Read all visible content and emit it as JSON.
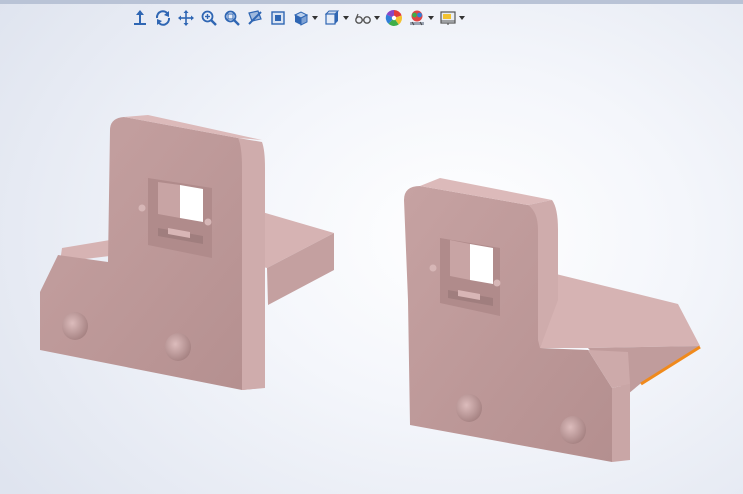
{
  "toolbar": {
    "items": [
      {
        "icon": "view-orientation-icon",
        "has_dropdown": false
      },
      {
        "icon": "rotate-view-icon",
        "has_dropdown": false
      },
      {
        "icon": "pan-icon",
        "has_dropdown": false
      },
      {
        "icon": "zoom-in-out-icon",
        "has_dropdown": false
      },
      {
        "icon": "zoom-to-area-icon",
        "has_dropdown": false
      },
      {
        "icon": "section-view-icon",
        "has_dropdown": false
      },
      {
        "icon": "previous-view-icon",
        "has_dropdown": false
      },
      {
        "icon": "view-orientation-cube-icon",
        "has_dropdown": true
      },
      {
        "icon": "display-style-icon",
        "has_dropdown": true
      },
      {
        "icon": "hide-show-items-icon",
        "has_dropdown": true
      },
      {
        "icon": "edit-appearance-icon",
        "has_dropdown": false
      },
      {
        "icon": "apply-scene-icon",
        "has_dropdown": true
      },
      {
        "icon": "view-settings-icon",
        "has_dropdown": true
      }
    ]
  },
  "colors": {
    "part_front": "#c09c9c",
    "part_top": "#d8b4b4",
    "part_side": "#cfacac",
    "part_dark": "#a88585",
    "highlight_edge": "#f08a1c",
    "toolbar_icon_blue": "#2f66b3"
  }
}
